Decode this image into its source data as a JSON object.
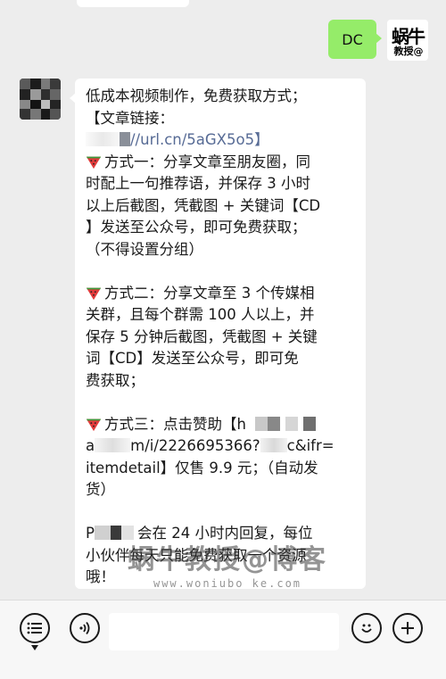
{
  "app": {
    "accent_green": "#95ec69"
  },
  "chat": {
    "outgoing": {
      "text": "DC",
      "avatar": {
        "logo_text": "蜗牛",
        "logo_sub": "教授@"
      }
    },
    "incoming": {
      "avatar": {
        "icon": "pixelated-avatar"
      },
      "lines": [
        "低成本视频制作，免费获取方式；",
        "【文章链接：",
        "//url.cn/5aGX5o5】",
        "方式一：分享文章至朋友圈，同",
        "时配上一句推荐语，并保存 3 小时",
        "以上后截图，凭截图 + 关键词【CD",
        "】发送至公众号，即可免费获取；",
        "（不得设置分组）",
        "",
        "方式二：分享文章至 3 个传媒相",
        "关群，且每个群需 100 人以上，并",
        "保存 5 分钟后截图，凭截图 + 关键",
        "词【CD】发送至公众号，即可免",
        "费获取；",
        "",
        "方式三：点击赞助【h",
        "a",
        "m/i/2226695366?",
        "c&ifr=",
        "itemdetail】仅售 9.9 元；（自动发",
        "货）",
        "",
        "P",
        "会在 24 小时内回复，每位",
        "小伙伴每天只能免费获取一个资源",
        "哦！"
      ]
    }
  },
  "watermark": {
    "main": "蜗牛教授@博客",
    "sub": "www.woniubo ke.com"
  },
  "input_bar": {
    "voice_icon": "voice-icon",
    "menu_icon": "menu-list-icon",
    "emoji_icon": "emoji-icon",
    "plus_icon": "plus-icon"
  }
}
